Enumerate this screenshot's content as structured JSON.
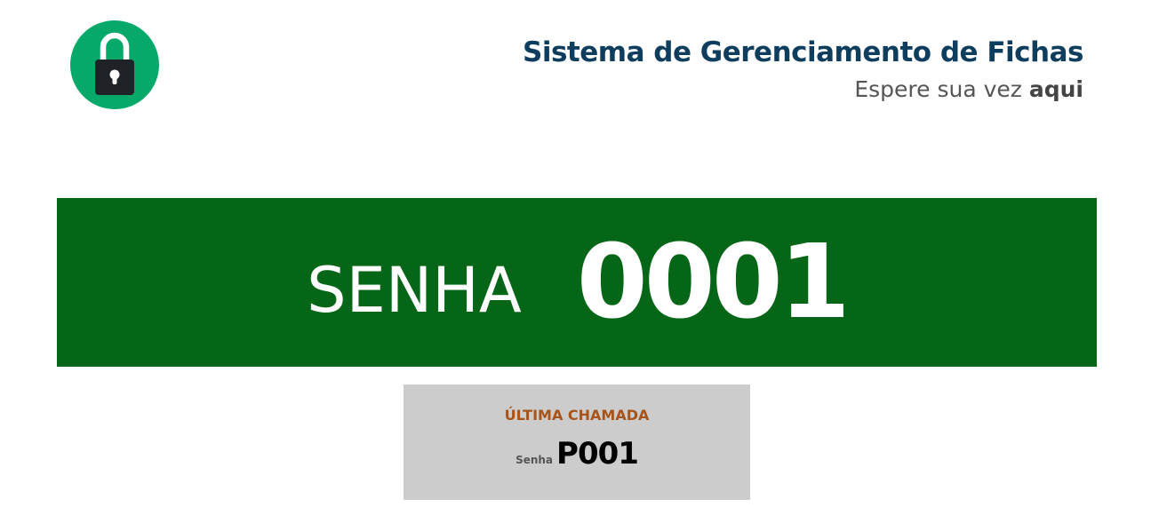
{
  "header": {
    "logo_icon": "padlock-icon",
    "logo_color": "#07a96b",
    "title": "Sistema de Gerenciamento de Fichas",
    "subtitle_prefix": "Espere sua vez",
    "subtitle_emphasis": "aqui"
  },
  "current_call": {
    "label": "SENHA",
    "number": "0001",
    "background_color": "#066617"
  },
  "last_call": {
    "title": "ÚLTIMA CHAMADA",
    "prefix": "Senha",
    "number": "P001",
    "background_color": "#cccccc",
    "title_color": "#a6541a"
  }
}
